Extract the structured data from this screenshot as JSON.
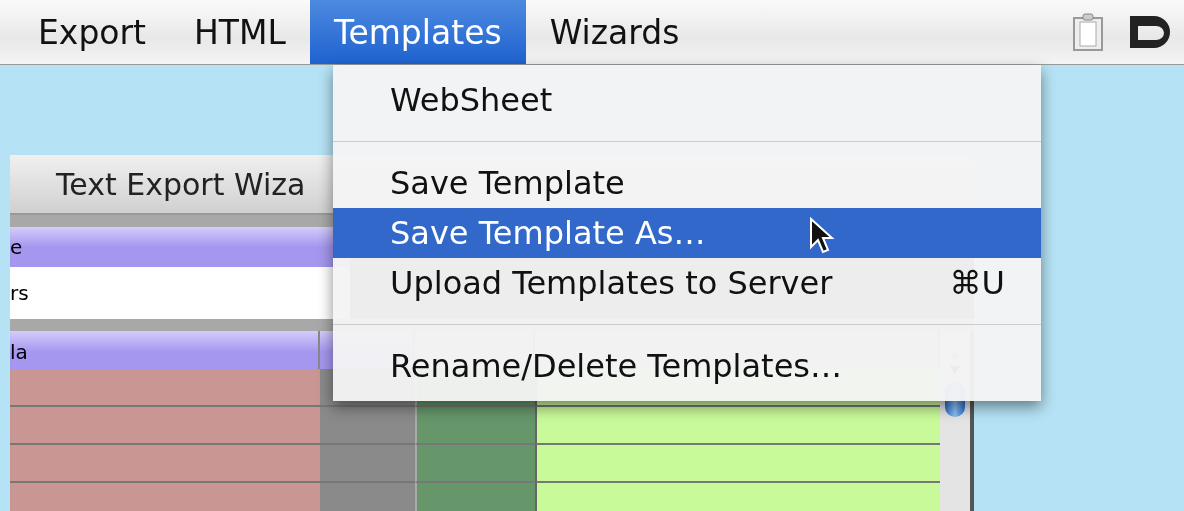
{
  "menu_bar": {
    "items": [
      {
        "label": "Export",
        "selected": false
      },
      {
        "label": "HTML",
        "selected": false
      },
      {
        "label": "Templates",
        "selected": true
      },
      {
        "label": "Wizards",
        "selected": false
      }
    ]
  },
  "window": {
    "title": "Text Export Wiza",
    "field_rows": [
      {
        "text": "e",
        "kind": "header"
      },
      {
        "text": "rs",
        "kind": "value"
      }
    ],
    "column_header": "la"
  },
  "dropdown": {
    "items": [
      {
        "kind": "item",
        "label": "WebSheet",
        "selected": false
      },
      {
        "kind": "separator"
      },
      {
        "kind": "item",
        "label": "Save Template",
        "selected": false
      },
      {
        "kind": "item",
        "label": "Save Template As…",
        "selected": true
      },
      {
        "kind": "item",
        "label": "Upload Templates to Server",
        "shortcut": "⌘U",
        "selected": false
      },
      {
        "kind": "separator"
      },
      {
        "kind": "item",
        "label": "Rename/Delete Templates…",
        "selected": false
      }
    ]
  }
}
